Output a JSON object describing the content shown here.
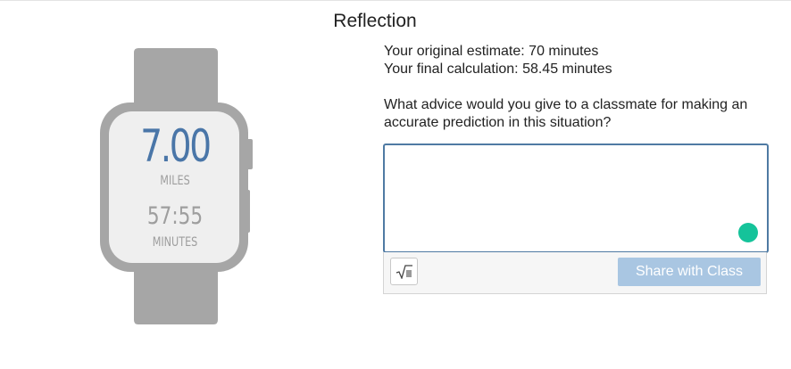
{
  "title": "Reflection",
  "watch": {
    "distance_value": "7.00",
    "distance_unit": "MILES",
    "time_value": "57:55",
    "time_unit": "MINUTES"
  },
  "info": {
    "estimate_line": "Your original estimate: 70 minutes",
    "calculation_line": "Your final calculation: 58.45 minutes"
  },
  "question": "What advice would you give to a classmate for making an accurate prediction in this situation?",
  "response": {
    "value": "",
    "placeholder": ""
  },
  "toolbar": {
    "math_icon": "square-root-icon",
    "share_label": "Share with Class"
  },
  "colors": {
    "accent": "#4a76a8",
    "share_button_disabled": "#a9c6e2",
    "grammar_icon": "#15c39a",
    "watch_body": "#a6a6a6"
  }
}
